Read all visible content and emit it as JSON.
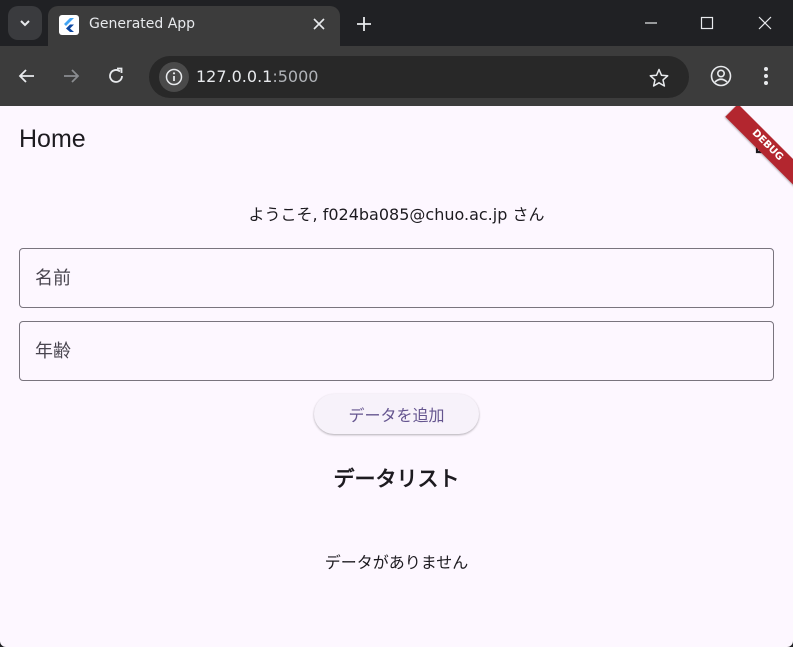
{
  "browser": {
    "tab_title": "Generated App",
    "url_host": "127.0.0.1",
    "url_port": ":5000"
  },
  "app": {
    "title": "Home",
    "debug_banner": "DEBUG",
    "welcome_text": "ようこそ, f024ba085@chuo.ac.jp さん",
    "name_field": {
      "placeholder": "名前",
      "value": ""
    },
    "age_field": {
      "placeholder": "年齢",
      "value": ""
    },
    "add_button_label": "データを追加",
    "list_heading": "データリスト",
    "empty_message": "データがありません"
  },
  "colors": {
    "app_background": "#fdf7ff",
    "accent": "#65558f",
    "browser_chrome": "#202124",
    "debug_ribbon": "#b3262f"
  },
  "icons": {
    "tab_search": "chevron-down-icon",
    "favicon": "flutter-icon",
    "tab_close": "close-icon",
    "new_tab": "plus-icon",
    "back": "back-arrow-icon",
    "forward": "forward-arrow-icon",
    "reload": "reload-icon",
    "site_info": "info-icon",
    "bookmark": "star-icon",
    "profile": "profile-icon",
    "menu": "kebab-menu-icon",
    "logout": "logout-icon"
  }
}
